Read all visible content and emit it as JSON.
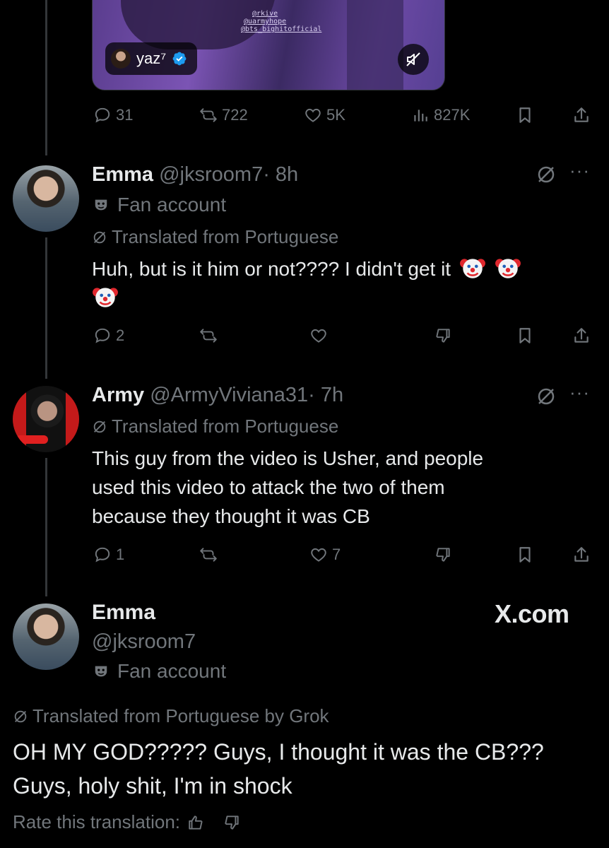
{
  "media": {
    "watermark": [
      "@rkive",
      "@uarmyhope",
      "@bts_bighitofficial"
    ],
    "author_pill": "yaz⁷",
    "mute_icon": "mute-icon"
  },
  "post_actions": {
    "replies": "31",
    "reposts": "722",
    "likes": "5K",
    "views": "827K"
  },
  "replies": [
    {
      "name": "Emma",
      "handle": "@jksroom7",
      "time": "· 8h",
      "badge": "Fan account",
      "translated": "Translated from Portuguese",
      "text": "Huh, but is it him or not???? I didn't get it",
      "emoji": "clown-face",
      "actions": {
        "replies": "2",
        "likes": ""
      }
    },
    {
      "name": "Army",
      "handle": "@ArmyViviana31",
      "time": "· 7h",
      "translated": "Translated from Portuguese",
      "text_lines": [
        "This guy from the video is Usher, and people",
        "used this video to attack the two of them",
        "because they thought it was CB"
      ],
      "actions": {
        "replies": "1",
        "likes": "7"
      }
    }
  ],
  "main_post": {
    "name": "Emma",
    "handle": "@jksroom7",
    "badge": "Fan account",
    "site": "X.com",
    "translated": "Translated from Portuguese by Grok",
    "text_lines": [
      "OH MY GOD????? Guys, I thought it was the CB???",
      "Guys, holy shit, I'm in shock"
    ],
    "rate_label": "Rate this translation:"
  },
  "colors": {
    "background": "#000000",
    "text": "#e7e9ea",
    "muted": "#71767b",
    "verified": "#1d9bf0"
  }
}
